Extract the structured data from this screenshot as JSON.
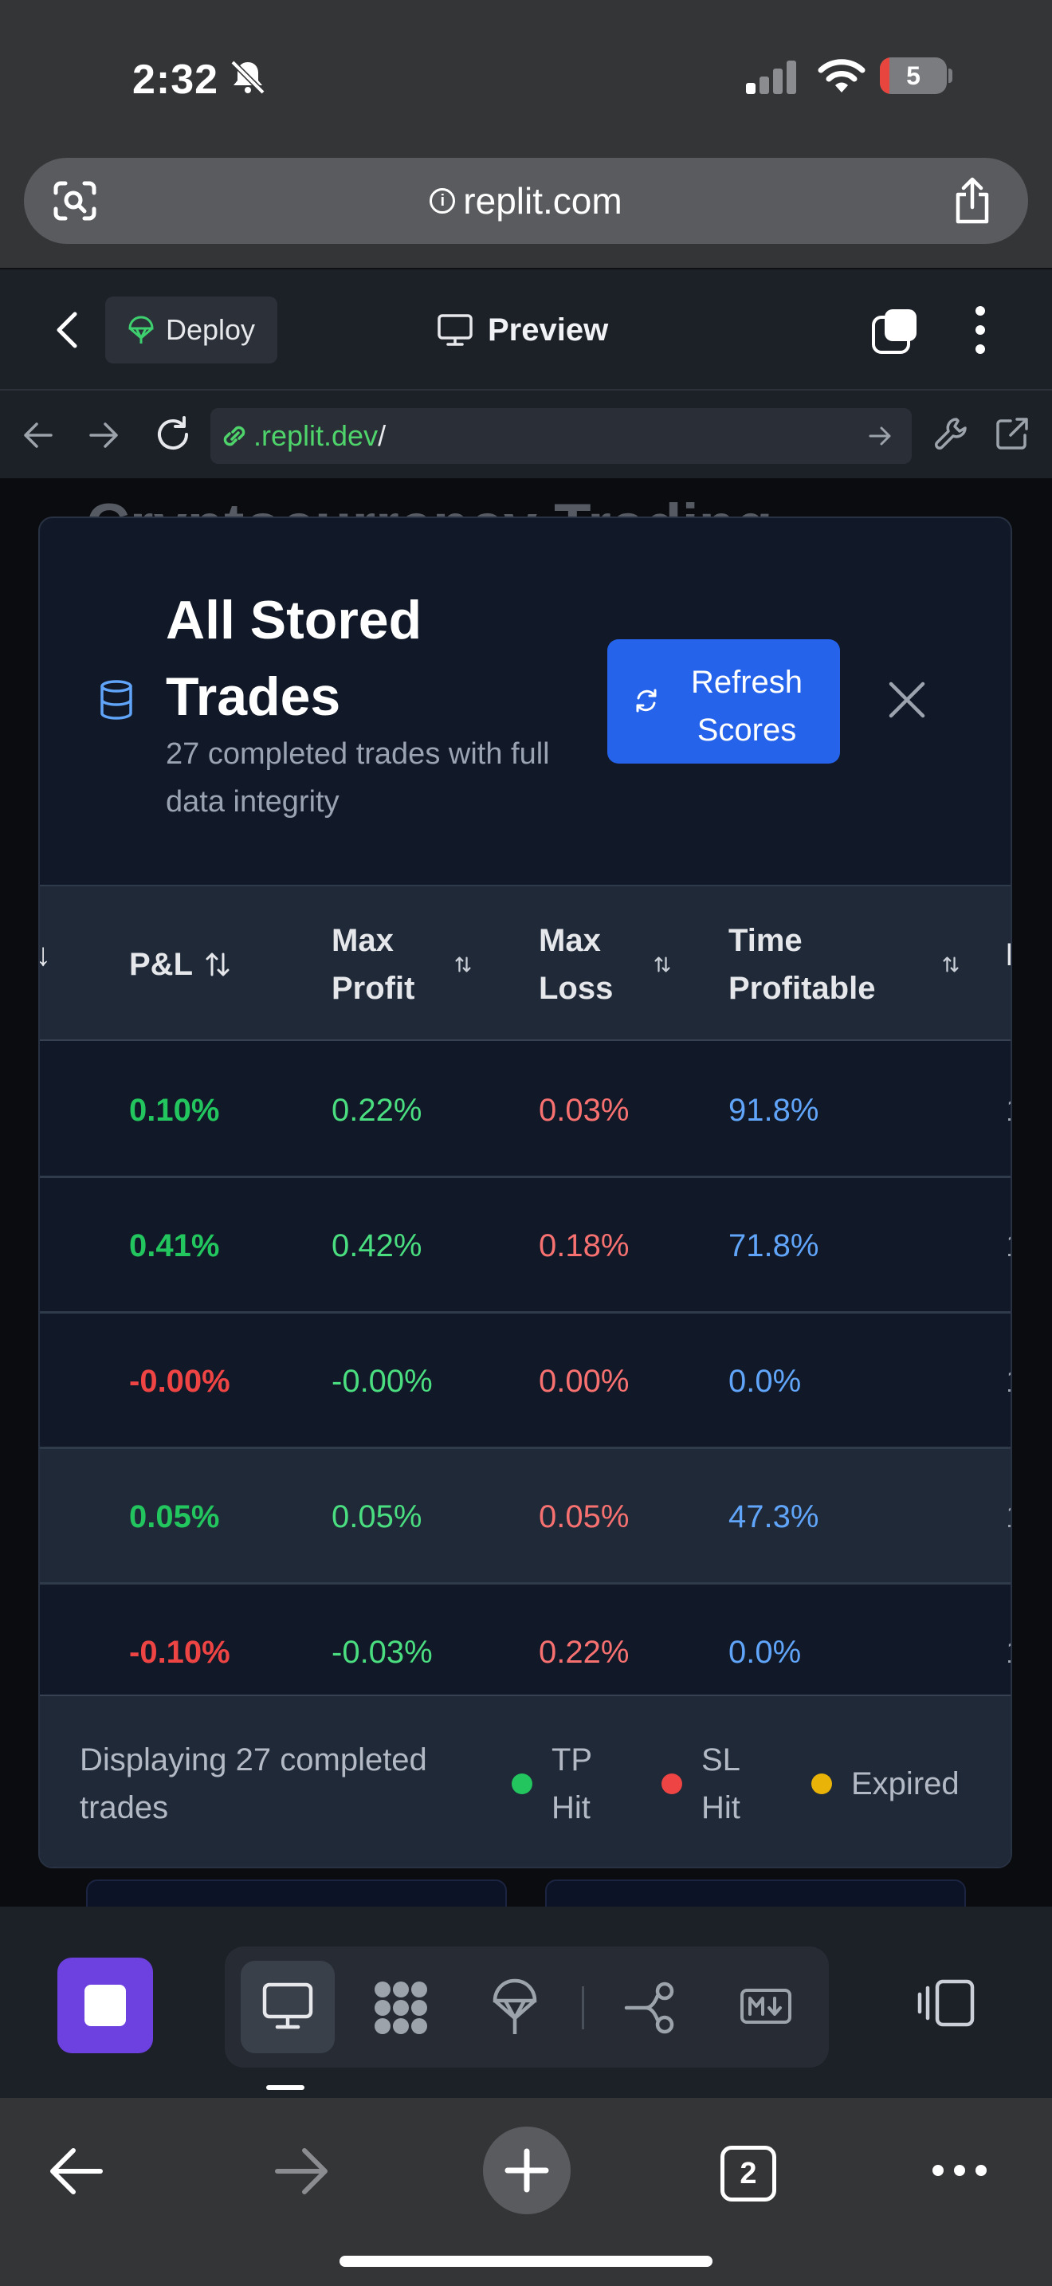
{
  "status_bar": {
    "time": "2:32",
    "battery_level": "5"
  },
  "safari": {
    "url": "replit.com",
    "open_tabs": "2"
  },
  "replit_header": {
    "deploy_label": "Deploy",
    "preview_label": "Preview"
  },
  "preview_nav": {
    "url_accent": ".replit.dev",
    "url_rest": "/"
  },
  "background": {
    "heading": "Cryptocurrency Trading"
  },
  "modal": {
    "title": "All Stored Trades",
    "subtitle": "27 completed trades with full data integrity",
    "refresh_label": "Refresh Scores",
    "columns": {
      "pnl": "P&L",
      "max_profit": "Max Profit",
      "max_loss": "Max Loss",
      "time_profitable": "Time Profitable"
    },
    "rows": [
      {
        "pnl": "0.10%",
        "max_profit": "0.22%",
        "max_loss": "0.03%",
        "time_profitable": "91.8%",
        "pnl_sign": "pos"
      },
      {
        "pnl": "0.41%",
        "max_profit": "0.42%",
        "max_loss": "0.18%",
        "time_profitable": "71.8%",
        "pnl_sign": "pos"
      },
      {
        "pnl": "-0.00%",
        "max_profit": "-0.00%",
        "max_loss": "0.00%",
        "time_profitable": "0.0%",
        "pnl_sign": "neg"
      },
      {
        "pnl": "0.05%",
        "max_profit": "0.05%",
        "max_loss": "0.05%",
        "time_profitable": "47.3%",
        "pnl_sign": "pos"
      },
      {
        "pnl": "-0.10%",
        "max_profit": "-0.03%",
        "max_loss": "0.22%",
        "time_profitable": "0.0%",
        "pnl_sign": "neg"
      }
    ],
    "footer_text": "Displaying 27 completed trades",
    "legend": [
      {
        "label": "TP Hit",
        "color": "#22c55e"
      },
      {
        "label": "SL Hit",
        "color": "#ef4444"
      },
      {
        "label": "Expired",
        "color": "#eab308"
      }
    ]
  },
  "colors": {
    "accent_blue": "#2563eb",
    "run_purple": "#6d40e0",
    "profit_green": "#22c55e",
    "loss_red": "#ef4444",
    "time_blue": "#60a5fa"
  },
  "icons": {
    "bell": "bell-slash-icon",
    "lens": "visual-lookup-icon",
    "share": "share-icon",
    "database": "database-icon",
    "refresh": "refresh-icon",
    "close": "close-icon",
    "sort": "sort-arrows-icon"
  }
}
